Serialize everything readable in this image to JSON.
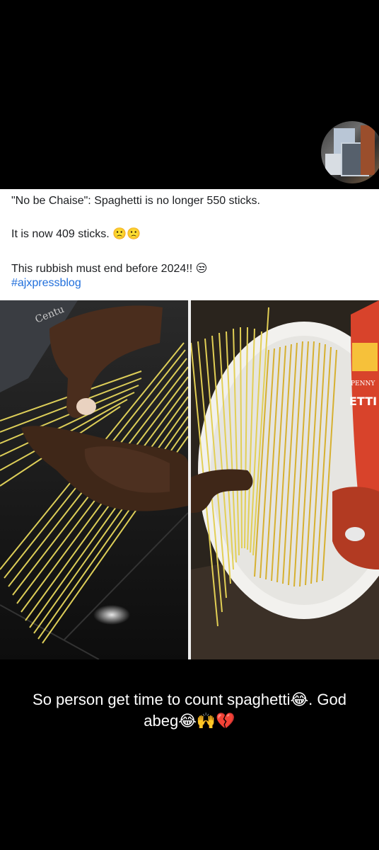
{
  "post": {
    "line1": "\"No be Chaise\": Spaghetti is no longer 550 sticks.",
    "line2": "It is now 409 sticks. 🙁🙁",
    "line3": "This rubbish must end before 2024!! 😒",
    "hashtag": "#ajxpressblog"
  },
  "photo_left": {
    "package_text": "Centu"
  },
  "photo_right": {
    "package_text_top": "PENNY",
    "package_text_main": "ETTI"
  },
  "caption": {
    "line1": "So person get time to count spaghetti😂. God",
    "line2": "abeg😂🙌💔"
  }
}
